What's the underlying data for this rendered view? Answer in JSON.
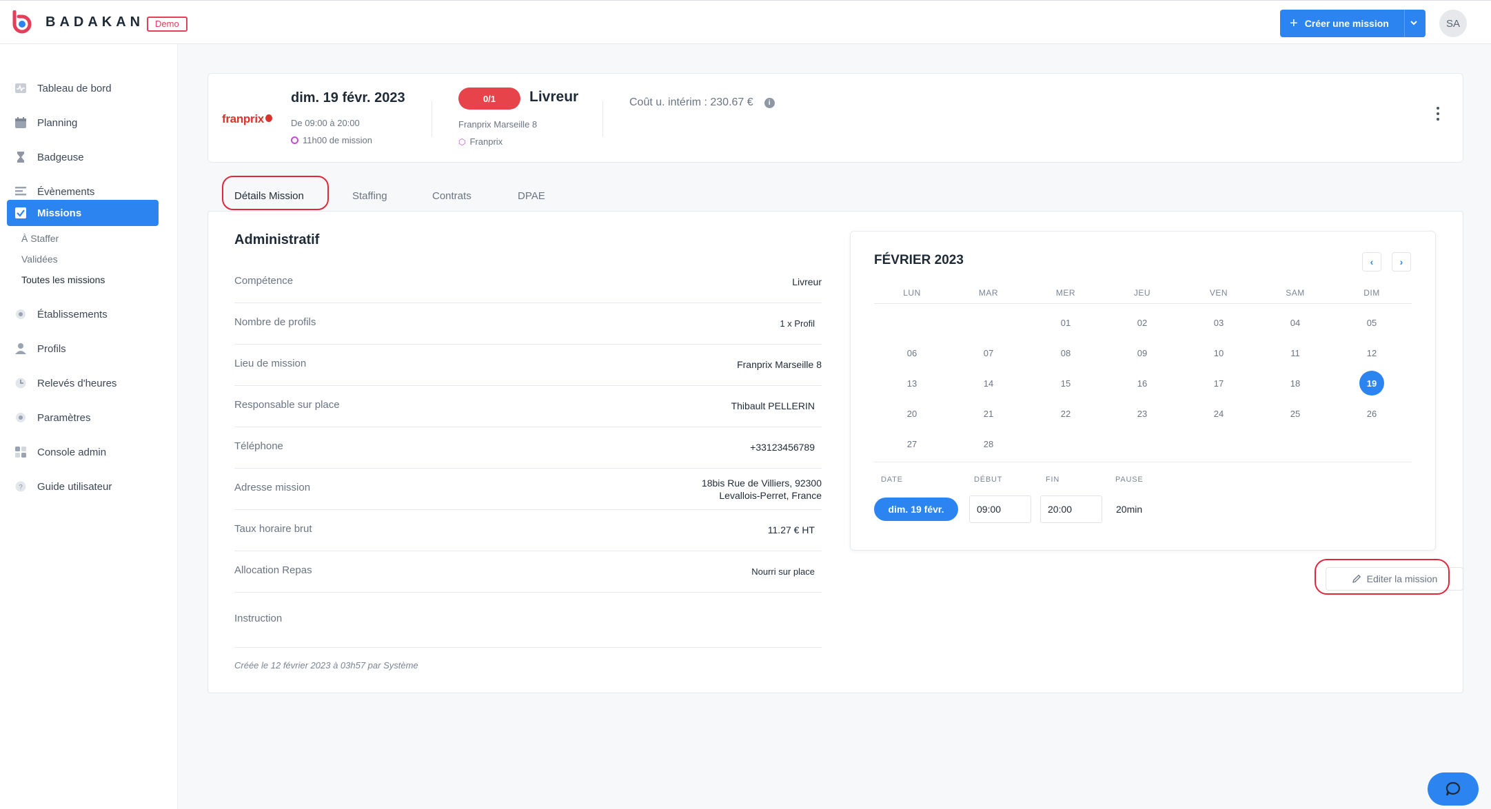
{
  "header": {
    "brand": "BADAKAN",
    "demo_badge": "Demo",
    "create_button": "Créer une mission",
    "avatar_initials": "SA"
  },
  "sidebar": {
    "items": [
      {
        "label": "Tableau de bord",
        "icon": "dashboard-icon"
      },
      {
        "label": "Planning",
        "icon": "calendar-icon"
      },
      {
        "label": "Badgeuse",
        "icon": "hourglass-icon"
      },
      {
        "label": "Évènements",
        "icon": "events-icon"
      },
      {
        "label": "Missions",
        "icon": "check-square-icon"
      },
      {
        "label": "Établissements",
        "icon": "building-icon"
      },
      {
        "label": "Profils",
        "icon": "user-icon"
      },
      {
        "label": "Relevés d'heures",
        "icon": "clock-icon"
      },
      {
        "label": "Paramètres",
        "icon": "gear-icon"
      },
      {
        "label": "Console admin",
        "icon": "grid-icon"
      },
      {
        "label": "Guide utilisateur",
        "icon": "help-icon"
      }
    ],
    "sub_items": [
      "À Staffer",
      "Validées",
      "Toutes les missions"
    ]
  },
  "mission": {
    "client_logo": "franprix",
    "date": "dim. 19 févr. 2023",
    "hours": "De 09:00 à 20:00",
    "duration": "11h00 de mission",
    "staffing": "0/1",
    "role": "Livreur",
    "place": "Franprix Marseille 8",
    "client": "Franprix",
    "cost": "Coût u. intérim : 230.67 €"
  },
  "tabs": [
    "Détails Mission",
    "Staffing",
    "Contrats",
    "DPAE"
  ],
  "admin": {
    "title": "Administratif",
    "rows": [
      {
        "label": "Compétence",
        "value": "Livreur"
      },
      {
        "label": "Nombre de profils",
        "value": "1 x Profil"
      },
      {
        "label": "Lieu de mission",
        "value": "Franprix Marseille 8"
      },
      {
        "label": "Responsable sur place",
        "value": "Thibault PELLERIN"
      },
      {
        "label": "Téléphone",
        "value": "+33123456789"
      },
      {
        "label": "Adresse mission",
        "value": "18bis Rue de Villiers, 92300",
        "value2": "Levallois-Perret, France"
      },
      {
        "label": "Taux horaire brut",
        "value": "11.27 € HT"
      },
      {
        "label": "Allocation Repas",
        "value": "Nourri sur place"
      },
      {
        "label": "Instruction",
        "value": ""
      }
    ],
    "created_note": "Créée le 12 février 2023 à 03h57 par Système"
  },
  "calendar": {
    "title": "FÉVRIER 2023",
    "weekdays": [
      "LUN",
      "MAR",
      "MER",
      "JEU",
      "VEN",
      "SAM",
      "DIM"
    ],
    "weeks": [
      [
        "",
        "",
        "01",
        "02",
        "03",
        "04",
        "05"
      ],
      [
        "06",
        "07",
        "08",
        "09",
        "10",
        "11",
        "12"
      ],
      [
        "13",
        "14",
        "15",
        "16",
        "17",
        "18",
        "19"
      ],
      [
        "20",
        "21",
        "22",
        "23",
        "24",
        "25",
        "26"
      ],
      [
        "27",
        "28",
        "",
        "",
        "",
        "",
        ""
      ]
    ],
    "selected_day": "19",
    "slot_headers": [
      "DATE",
      "DÉBUT",
      "FIN",
      "PAUSE"
    ],
    "slot": {
      "date": "dim. 19 févr.",
      "start": "09:00",
      "end": "20:00",
      "pause": "20min"
    }
  },
  "edit_button": "Editer la mission",
  "colors": {
    "accent": "#2b84f0",
    "danger": "#e6434b",
    "highlight": "#e0263a"
  }
}
